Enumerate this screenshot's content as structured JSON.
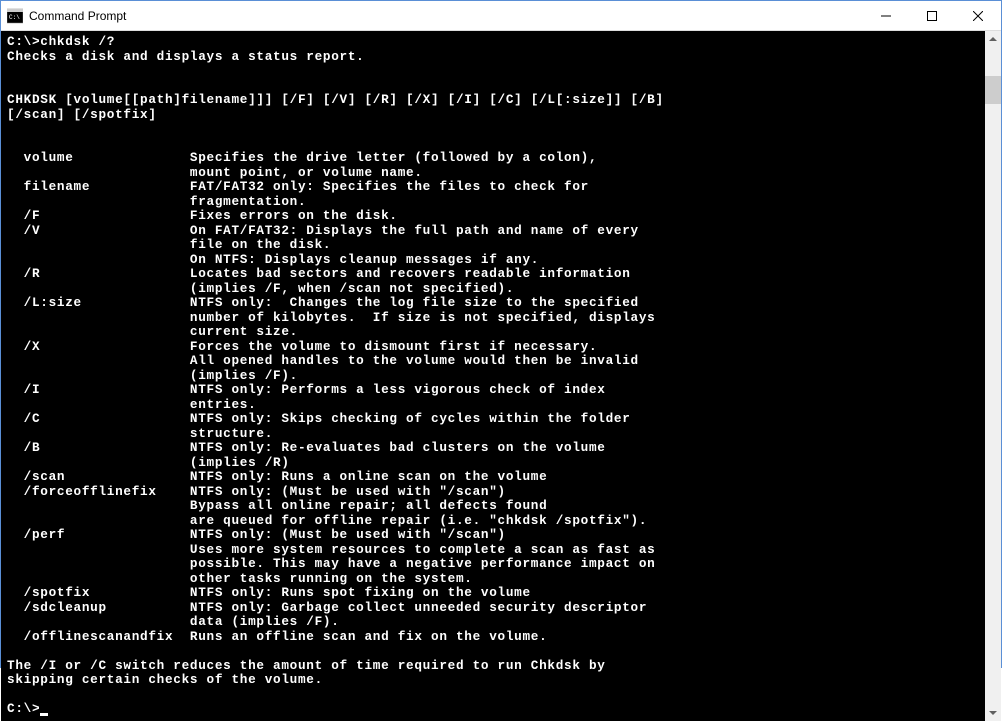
{
  "window": {
    "title": "Command Prompt"
  },
  "console": {
    "lines": [
      "C:\\>chkdsk /?",
      "Checks a disk and displays a status report.",
      "",
      "",
      "CHKDSK [volume[[path]filename]]] [/F] [/V] [/R] [/X] [/I] [/C] [/L[:size]] [/B]",
      "[/scan] [/spotfix]",
      "",
      "",
      "  volume              Specifies the drive letter (followed by a colon),",
      "                      mount point, or volume name.",
      "  filename            FAT/FAT32 only: Specifies the files to check for",
      "                      fragmentation.",
      "  /F                  Fixes errors on the disk.",
      "  /V                  On FAT/FAT32: Displays the full path and name of every",
      "                      file on the disk.",
      "                      On NTFS: Displays cleanup messages if any.",
      "  /R                  Locates bad sectors and recovers readable information",
      "                      (implies /F, when /scan not specified).",
      "  /L:size             NTFS only:  Changes the log file size to the specified",
      "                      number of kilobytes.  If size is not specified, displays",
      "                      current size.",
      "  /X                  Forces the volume to dismount first if necessary.",
      "                      All opened handles to the volume would then be invalid",
      "                      (implies /F).",
      "  /I                  NTFS only: Performs a less vigorous check of index",
      "                      entries.",
      "  /C                  NTFS only: Skips checking of cycles within the folder",
      "                      structure.",
      "  /B                  NTFS only: Re-evaluates bad clusters on the volume",
      "                      (implies /R)",
      "  /scan               NTFS only: Runs a online scan on the volume",
      "  /forceofflinefix    NTFS only: (Must be used with \"/scan\")",
      "                      Bypass all online repair; all defects found",
      "                      are queued for offline repair (i.e. \"chkdsk /spotfix\").",
      "  /perf               NTFS only: (Must be used with \"/scan\")",
      "                      Uses more system resources to complete a scan as fast as",
      "                      possible. This may have a negative performance impact on",
      "                      other tasks running on the system.",
      "  /spotfix            NTFS only: Runs spot fixing on the volume",
      "  /sdcleanup          NTFS only: Garbage collect unneeded security descriptor",
      "                      data (implies /F).",
      "  /offlinescanandfix  Runs an offline scan and fix on the volume.",
      "",
      "The /I or /C switch reduces the amount of time required to run Chkdsk by",
      "skipping certain checks of the volume.",
      "",
      "C:\\>"
    ]
  }
}
